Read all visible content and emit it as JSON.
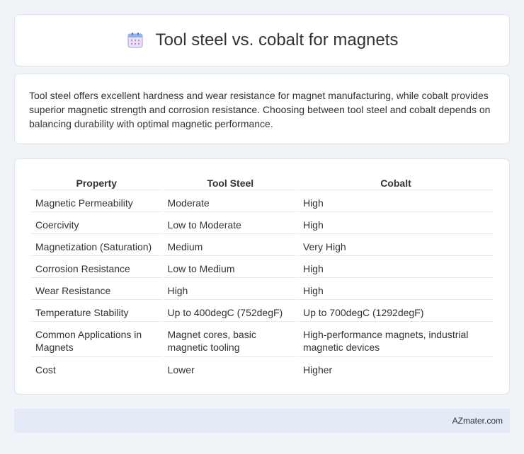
{
  "header": {
    "title": "Tool steel vs. cobalt for magnets",
    "icon": "calendar-icon"
  },
  "intro": {
    "text": "Tool steel offers excellent hardness and wear resistance for magnet manufacturing, while cobalt provides superior magnetic strength and corrosion resistance. Choosing between tool steel and cobalt depends on balancing durability with optimal magnetic performance."
  },
  "table": {
    "headers": [
      "Property",
      "Tool Steel",
      "Cobalt"
    ],
    "rows": [
      [
        "Magnetic Permeability",
        "Moderate",
        "High"
      ],
      [
        "Coercivity",
        "Low to Moderate",
        "High"
      ],
      [
        "Magnetization (Saturation)",
        "Medium",
        "Very High"
      ],
      [
        "Corrosion Resistance",
        "Low to Medium",
        "High"
      ],
      [
        "Wear Resistance",
        "High",
        "High"
      ],
      [
        "Temperature Stability",
        "Up to 400degC (752degF)",
        "Up to 700degC (1292degF)"
      ],
      [
        "Common Applications in Magnets",
        "Magnet cores, basic magnetic tooling",
        "High-performance magnets, industrial magnetic devices"
      ],
      [
        "Cost",
        "Lower",
        "Higher"
      ]
    ]
  },
  "footer": {
    "text": "AZmater.com"
  },
  "colors": {
    "background": "#f0f3f8",
    "footer_bg": "#e4ebf6",
    "icon_accent": "#9b7fd4"
  }
}
